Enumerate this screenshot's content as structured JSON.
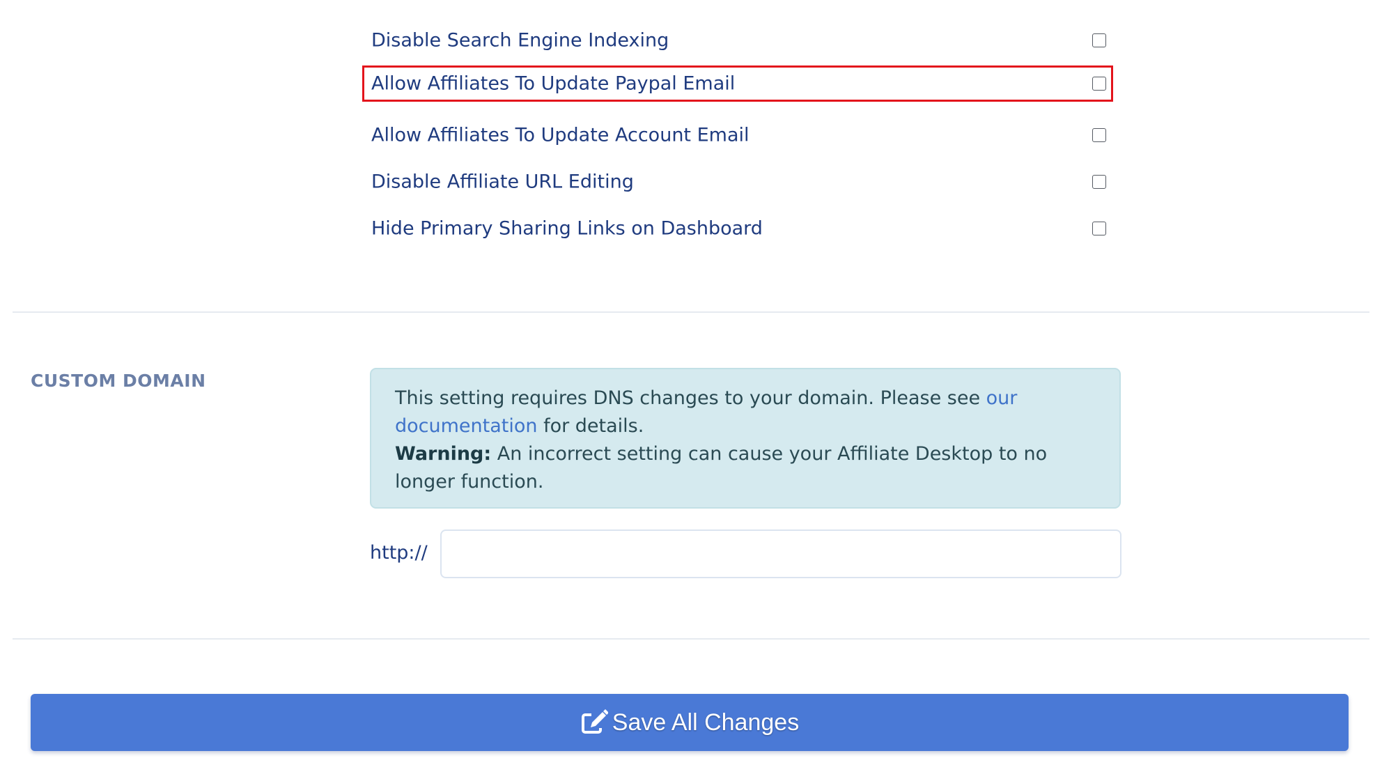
{
  "options": [
    {
      "label": "Disable Search Engine Indexing",
      "checked": false
    },
    {
      "label": "Allow Affiliates To Update Paypal Email",
      "checked": false,
      "highlighted": true
    },
    {
      "label": "Allow Affiliates To Update Account Email",
      "checked": false
    },
    {
      "label": "Disable Affiliate URL Editing",
      "checked": false
    },
    {
      "label": "Hide Primary Sharing Links on Dashboard",
      "checked": false
    }
  ],
  "custom_domain": {
    "title": "CUSTOM DOMAIN",
    "notice": {
      "text_before_link": "This setting requires DNS changes to your domain. Please see ",
      "link_text": "our documentation",
      "text_after_link": " for details.",
      "warning_label": "Warning:",
      "warning_text": " An incorrect setting can cause your Affiliate Desktop to no longer function."
    },
    "prefix": "http://",
    "input_value": "",
    "input_placeholder": ""
  },
  "save_button": {
    "label": "Save All Changes",
    "icon": "edit-icon"
  },
  "colors": {
    "accent": "#4a79d6",
    "link": "#3f73c9",
    "highlight_border": "#e3141c",
    "notice_bg": "#d5eaef",
    "label_text": "#1f3b7f"
  }
}
